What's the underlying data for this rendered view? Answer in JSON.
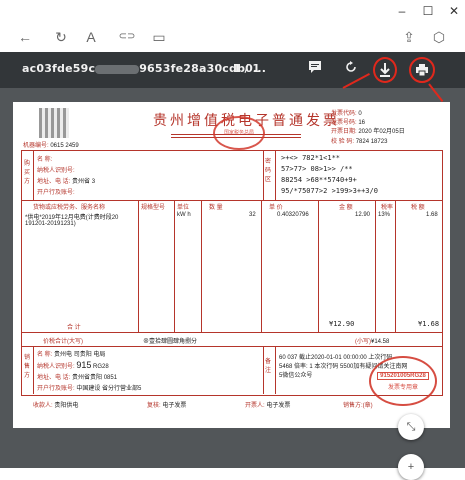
{
  "window": {
    "minimize_glyph": "–",
    "maximize_glyph": "☐",
    "close_glyph": "✕"
  },
  "browser": {
    "back_glyph": "←",
    "refresh_glyph": "↻",
    "read_glyph": "A",
    "link_glyph": "⊂⊃",
    "tab_glyph": "▭",
    "share_glyph": "⇪",
    "extension_glyph": "⬡"
  },
  "viewer": {
    "file_name_start": "ac03fde59c",
    "file_name_end": "9653fe28a30cdb0...",
    "page_current": "1",
    "page_separator": "/",
    "page_total": "1",
    "fit_button_glyph": "⤡",
    "zoom_in_glyph": "+"
  },
  "invoice": {
    "title": "贵州增值税电子普通发票",
    "machine_no_label": "机器编号:",
    "machine_no_value": "0615",
    "machine_no_suffix": "2459",
    "code_label": "发票代码:",
    "code_value": "0",
    "number_label": "发票号码:",
    "number_suffix": "16",
    "date_label": "开票日期:",
    "date_value": "2020 年02月05日",
    "check_label": "校 验 码:",
    "check_value": "7824",
    "check_suffix": "18723",
    "buyer_label": "购买方",
    "name_label": "名 称:",
    "tax_id_label": "纳税人识别号:",
    "addr_label": "地址、电 话:",
    "addr_value": "贵州省",
    "addr_suffix": "3",
    "bank_label": "开户行及账号:",
    "cipher_label": "密码区",
    "cipher_line1": ">+<>          782*1<1**",
    "cipher_line2": "57>77>      08>1>>      /**",
    "cipher_line3": "88254          >68**5740+9+",
    "cipher_line4": "95/*75077>2     >199>3++3/0",
    "col_item": "货物或应税劳务、服务名称",
    "col_spec": "规格型号",
    "col_unit": "单位",
    "col_qty": "数 量",
    "col_price": "单 价",
    "col_amount": "金 额",
    "col_rate": "税率",
    "col_tax": "税 额",
    "item_line1": "*供电*2019年12月电费(计费时段20",
    "item_line2": "191201-20191231)",
    "item_unit": "kW h",
    "item_qty": "32",
    "item_price": "0.40320796",
    "item_amount": "12.90",
    "item_rate": "13%",
    "item_tax": "1.68",
    "total_label": "合 计",
    "total_amount": "¥12.90",
    "total_tax": "¥1.68",
    "grand_label": "价税合计(大写)",
    "grand_words": "⊗壹拾肆圆肆角捌分",
    "grand_small_label": "(小写)",
    "grand_small_value": "¥14.58",
    "seller_label": "销售方",
    "seller_name_value": "贵州电",
    "seller_name_suffix": "司贵阳",
    "seller_name_end": "电局",
    "seller_tax_value": "915",
    "seller_tax_suffix": "RG28",
    "seller_addr_value": "贵州省贵阳",
    "seller_addr_mid": "0851",
    "seller_bank_value": "中国建设",
    "seller_bank_suffix": "省分行营业部5",
    "remark_label": "备注",
    "remark_line1": "60",
    "remark_line1b": "037 截止2020-01-01 00:00:00 上次行码",
    "remark_line2": "5468 倍率: 1 本次行码 5500加有疑问请关注南网",
    "remark_line3": "5微信公众号",
    "payee_label": "收款人:",
    "payee_value": "贵阳供电",
    "reviewer_label": "复核:",
    "reviewer_value": "电子发票",
    "issuer_label": "开票人:",
    "issuer_value": "电子发票",
    "seller_sign_label": "销售方:(章)",
    "stamp_top_text": "全国统一发票监制章",
    "stamp_bottom_text": "国家税务总局",
    "seller_stamp_code": "915201005RG28",
    "seller_stamp_label": "发票专用章"
  }
}
